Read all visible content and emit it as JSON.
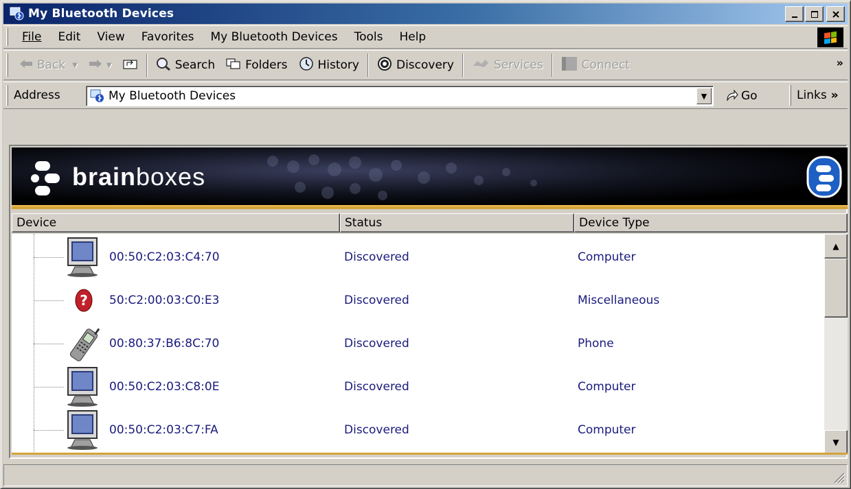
{
  "window": {
    "title": "My Bluetooth Devices",
    "controls": {
      "minimize": "_",
      "maximize": "□",
      "close": "×"
    }
  },
  "menu": {
    "items": [
      {
        "label": "File",
        "icon": ""
      },
      {
        "label": "Edit"
      },
      {
        "label": "View"
      },
      {
        "label": "Favorites"
      },
      {
        "label": "My Bluetooth Devices"
      },
      {
        "label": "Tools"
      },
      {
        "label": "Help"
      }
    ]
  },
  "toolbar": {
    "back": "Back",
    "search": "Search",
    "folders": "Folders",
    "history": "History",
    "discovery": "Discovery",
    "services": "Services",
    "connect": "Connect",
    "overflow": "»"
  },
  "address": {
    "label": "Address",
    "value": "My Bluetooth Devices",
    "go": "Go",
    "links": "Links",
    "links_overflow": "»"
  },
  "banner": {
    "brand_bold": "brain",
    "brand_light": "boxes"
  },
  "list": {
    "columns": [
      "Device",
      "Status",
      "Device Type"
    ],
    "rows": [
      {
        "device": "00:50:C2:03:C4:70",
        "status": "Discovered",
        "type": "Computer",
        "icon": "computer-icon"
      },
      {
        "device": "50:C2:00:03:C0:E3",
        "status": "Discovered",
        "type": "Miscellaneous",
        "icon": "question-icon"
      },
      {
        "device": "00:80:37:B6:8C:70",
        "status": "Discovered",
        "type": "Phone",
        "icon": "phone-icon"
      },
      {
        "device": "00:50:C2:03:C8:0E",
        "status": "Discovered",
        "type": "Computer",
        "icon": "computer-icon"
      },
      {
        "device": "00:50:C2:03:C7:FA",
        "status": "Discovered",
        "type": "Computer",
        "icon": "computer-icon"
      }
    ]
  },
  "colors": {
    "title_start": "#0a246a",
    "title_end": "#a6caf0",
    "accent_gold": "#d4a33a",
    "link_text": "#1a1a7e"
  }
}
